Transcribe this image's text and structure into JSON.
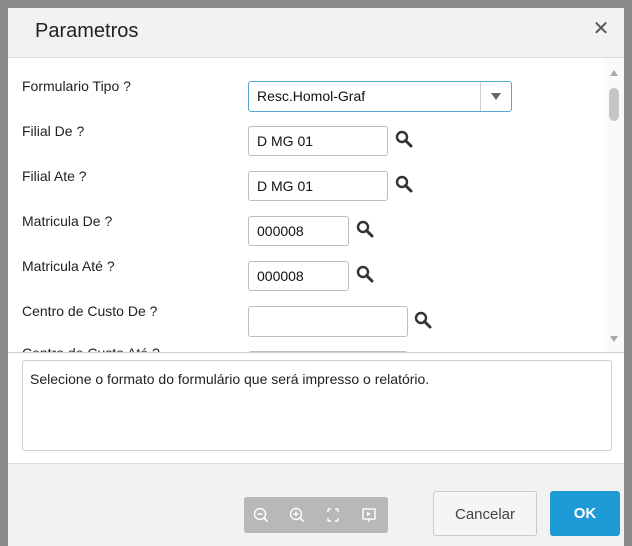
{
  "dialog": {
    "title": "Parametros",
    "close_icon": "close-icon"
  },
  "params": [
    {
      "label": "Formulario Tipo ?",
      "value": "Resc.Homol-Graf",
      "kind": "select"
    },
    {
      "label": "Filial De ?",
      "value": "D MG 01",
      "kind": "lookup"
    },
    {
      "label": "Filial Ate ?",
      "value": "D MG 01",
      "kind": "lookup"
    },
    {
      "label": "Matricula De ?",
      "value": "000008",
      "kind": "lookup"
    },
    {
      "label": "Matricula Até ?",
      "value": "000008",
      "kind": "lookup"
    },
    {
      "label": "Centro de Custo De ?",
      "value": "",
      "kind": "lookup"
    },
    {
      "label": "Centro de Custo Até ?",
      "value": "",
      "kind": "lookup"
    }
  ],
  "help_text": "Selecione o formato do formulário que será impresso o relatório.",
  "footer": {
    "zoom_icons": [
      "zoom-out-icon",
      "zoom-in-icon",
      "fit-screen-icon",
      "present-icon"
    ],
    "cancel_label": "Cancelar",
    "ok_label": "OK"
  },
  "colors": {
    "primary": "#1e9ad6",
    "select_border": "#56a8d4"
  }
}
